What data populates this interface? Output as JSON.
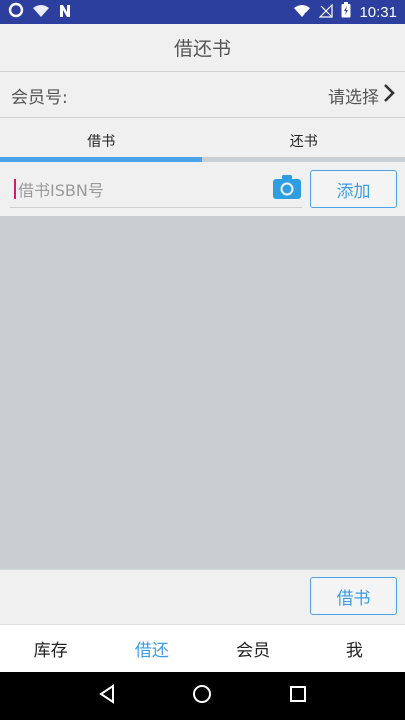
{
  "status_bar": {
    "time": "10:31",
    "icons": [
      "sync-icon",
      "wifi-icon",
      "n-notification-icon",
      "wifi-off-icon",
      "no-signal-icon",
      "battery-charging-icon"
    ]
  },
  "app_bar": {
    "title": "借还书"
  },
  "member": {
    "label": "会员号:",
    "select_text": "请选择"
  },
  "tabs": {
    "items": [
      {
        "label": "借书",
        "active": true
      },
      {
        "label": "还书",
        "active": false
      }
    ]
  },
  "isbn_input": {
    "placeholder": "借书ISBN号",
    "value": ""
  },
  "buttons": {
    "add": "添加",
    "borrow": "借书"
  },
  "bottom_nav": {
    "items": [
      {
        "label": "库存",
        "active": false
      },
      {
        "label": "借还",
        "active": true
      },
      {
        "label": "会员",
        "active": false
      },
      {
        "label": "我",
        "active": false
      }
    ]
  },
  "colors": {
    "status_bar": "#2c3e9e",
    "accent": "#3d9ee6",
    "list_bg": "#c9cfd0"
  }
}
